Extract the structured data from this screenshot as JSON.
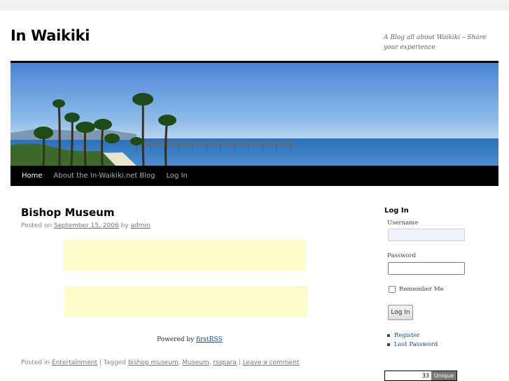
{
  "site": {
    "title": "In Waikiki",
    "description": "A Blog all about Waikiki – Share your experience"
  },
  "nav": {
    "items": [
      "Home",
      "About the In-Waikiki.net Blog",
      "Log In"
    ],
    "current": "Home"
  },
  "post": {
    "title": "Bishop Museum",
    "posted_on_label": "Posted on",
    "date": "September 15, 2006",
    "by_label": "by",
    "author": "admin",
    "powered_by_label": "Powered by",
    "powered_by_link": "firstRSS",
    "posted_in_label": "Posted in",
    "category": "Entertainment",
    "tagged_label": "| Tagged",
    "tags": [
      "bishop museum",
      "Museum",
      "rsspara"
    ],
    "leave_comment": "Leave a comment"
  },
  "sidebar": {
    "login_title": "Log In",
    "username_label": "Username",
    "username_value": "",
    "password_label": "Password",
    "password_value": "",
    "remember_label": "Remember Me",
    "remember_checked": false,
    "login_button": "Log In",
    "links": [
      "Register",
      "Lost Password"
    ],
    "counter_value": "33",
    "counter_label": "Unique"
  },
  "colors": {
    "nav_background": "#000000",
    "ad_background": "#fffccc",
    "link_blue": "#1a4b9e"
  }
}
